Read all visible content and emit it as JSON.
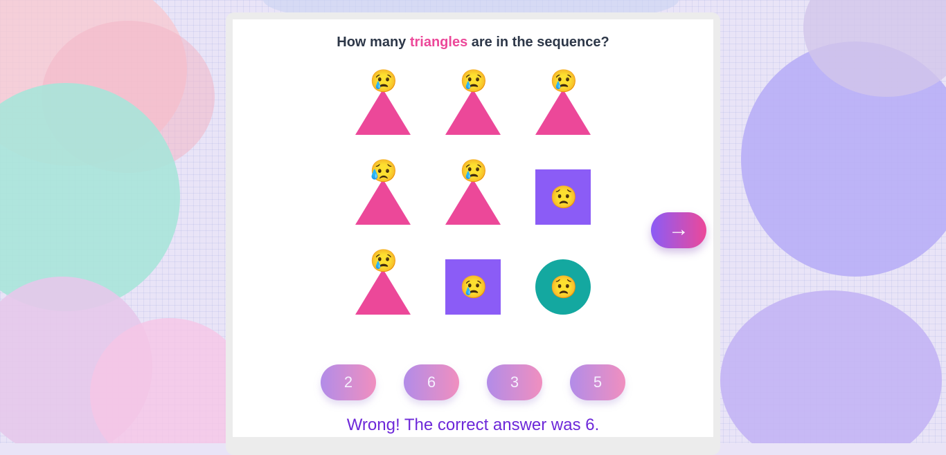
{
  "question": {
    "prefix": "How many ",
    "highlight": "triangles",
    "suffix": " are in the sequence?"
  },
  "grid": [
    {
      "shape": "triangle",
      "emoji": "😢"
    },
    {
      "shape": "triangle",
      "emoji": "😢"
    },
    {
      "shape": "triangle",
      "emoji": "😢"
    },
    {
      "shape": "triangle",
      "emoji": "😥"
    },
    {
      "shape": "triangle",
      "emoji": "😢"
    },
    {
      "shape": "square",
      "emoji": "😟"
    },
    {
      "shape": "triangle",
      "emoji": "😢"
    },
    {
      "shape": "square",
      "emoji": "😢"
    },
    {
      "shape": "circle",
      "emoji": "😟"
    }
  ],
  "options": [
    "2",
    "6",
    "3",
    "5"
  ],
  "result": "Wrong! The correct answer was 6.",
  "next_label": "→",
  "colors": {
    "triangle": "#ec4899",
    "square": "#8b5cf6",
    "circle": "#14a8a0",
    "result_text": "#6d28d9"
  }
}
